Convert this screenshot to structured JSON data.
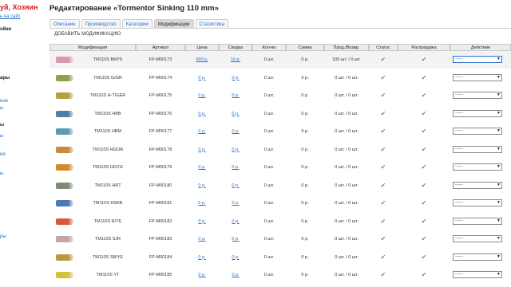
{
  "sidebar": {
    "greeting": "уй, Хозяин",
    "site_link": "ь на сайт",
    "items": [
      {
        "label": "ойки",
        "style": "bold"
      },
      {
        "label": "ары",
        "style": "bold"
      },
      {
        "label": "ное",
        "style": "link"
      },
      {
        "label": "ы",
        "style": "link"
      },
      {
        "label": "ы",
        "style": "bold"
      },
      {
        "label": "ы",
        "style": "link"
      },
      {
        "label": "ия",
        "style": "link"
      },
      {
        "label": "ы",
        "style": "link"
      },
      {
        "label": "ры",
        "style": "link"
      }
    ]
  },
  "page_title": "Редактирование «Tormentor Sinking 110 mm»",
  "tabs": [
    "Описание",
    "Производство",
    "Категории",
    "Модификации",
    "Статистика"
  ],
  "active_tab": "Модификации",
  "add_modification_label": "ДОБАВИТЬ МОДИФИКАЦИЮ",
  "table": {
    "columns": [
      "Модификация",
      "Артикул",
      "Цена",
      "Скидка",
      "Кол-во",
      "Сумма",
      "Прод./Возвр.",
      "Статус",
      "Распродажа",
      "Действие"
    ],
    "rows": [
      {
        "name": "TM110S BKPS",
        "sku": "FP-M00173",
        "price": "990 р.",
        "discount": "10 р.",
        "qty": "0 шт.",
        "sum": "0 р.",
        "sales": "100 шт. / 0 шт.",
        "action": "------",
        "thumb": "#d99aa6"
      },
      {
        "name": "TM110S G/GR",
        "sku": "FP-M00174",
        "price": "0 р.",
        "discount": "0 р.",
        "qty": "0 шт.",
        "sum": "0 р.",
        "sales": "0 шт. / 0 шт.",
        "action": "------",
        "thumb": "#8aa24a"
      },
      {
        "name": "TM110S H-TIGER",
        "sku": "FP-M00175",
        "price": "0 р.",
        "discount": "0 р.",
        "qty": "0 шт.",
        "sum": "0 р.",
        "sales": "0 шт. / 0 шт.",
        "action": "------",
        "thumb": "#b5a03c"
      },
      {
        "name": "TM110S HBB",
        "sku": "FP-M00176",
        "price": "0 р.",
        "discount": "0 р.",
        "qty": "0 шт.",
        "sum": "0 р.",
        "sales": "0 шт. / 0 шт.",
        "action": "------",
        "thumb": "#4f7fa6"
      },
      {
        "name": "TM110S HBM",
        "sku": "FP-M00177",
        "price": "0 р.",
        "discount": "0 р.",
        "qty": "0 шт.",
        "sum": "0 р.",
        "sales": "0 шт. / 0 шт.",
        "action": "------",
        "thumb": "#5d9ab0"
      },
      {
        "name": "TM110S HGOR",
        "sku": "FP-M00178",
        "price": "0 р.",
        "discount": "0 р.",
        "qty": "0 шт.",
        "sum": "0 р.",
        "sales": "0 шт. / 0 шт.",
        "action": "------",
        "thumb": "#c98b3a"
      },
      {
        "name": "TM110S HGYG",
        "sku": "FP-M00179",
        "price": "0 р.",
        "discount": "0 р.",
        "qty": "0 шт.",
        "sum": "0 р.",
        "sales": "0 шт. / 0 шт.",
        "action": "------",
        "thumb": "#d48a2a"
      },
      {
        "name": "TM110S HRT",
        "sku": "FP-M00180",
        "price": "0 р.",
        "discount": "0 р.",
        "qty": "0 шт.",
        "sum": "0 р.",
        "sales": "0 шт. / 0 шт.",
        "action": "------",
        "thumb": "#7c8c76"
      },
      {
        "name": "TM110S HSKB",
        "sku": "FP-M00181",
        "price": "0 р.",
        "discount": "0 р.",
        "qty": "0 шт.",
        "sum": "0 р.",
        "sales": "0 шт. / 0 шт.",
        "action": "------",
        "thumb": "#4a78b8"
      },
      {
        "name": "TM110S R/YE",
        "sku": "FP-M00182",
        "price": "0 р.",
        "discount": "0 р.",
        "qty": "0 шт.",
        "sum": "0 р.",
        "sales": "0 шт. / 0 шт.",
        "action": "------",
        "thumb": "#d65a3a"
      },
      {
        "name": "TM110S SJR",
        "sku": "FP-M00183",
        "price": "0 р.",
        "discount": "0 р.",
        "qty": "0 шт.",
        "sum": "0 р.",
        "sales": "0 шт. / 0 шт.",
        "action": "------",
        "thumb": "#c9a2a8"
      },
      {
        "name": "TM110S SB/YE",
        "sku": "FP-M00184",
        "price": "0 р.",
        "discount": "0 р.",
        "qty": "0 шт.",
        "sum": "0 р.",
        "sales": "0 шт. / 0 шт.",
        "action": "------",
        "thumb": "#b89a3a"
      },
      {
        "name": "TM110S YT",
        "sku": "FP-M00185",
        "price": "0 р.",
        "discount": "0 р.",
        "qty": "0 шт.",
        "sum": "0 р.",
        "sales": "0 шт. / 0 шт.",
        "action": "------",
        "thumb": "#d4c23a"
      }
    ]
  },
  "colors": {
    "link": "#2a6fc9",
    "status_ok": "#5aa83c",
    "greeting": "#d61a1a"
  },
  "icons": {
    "status": "check-icon",
    "select_arrow": "chevron-down-icon"
  }
}
